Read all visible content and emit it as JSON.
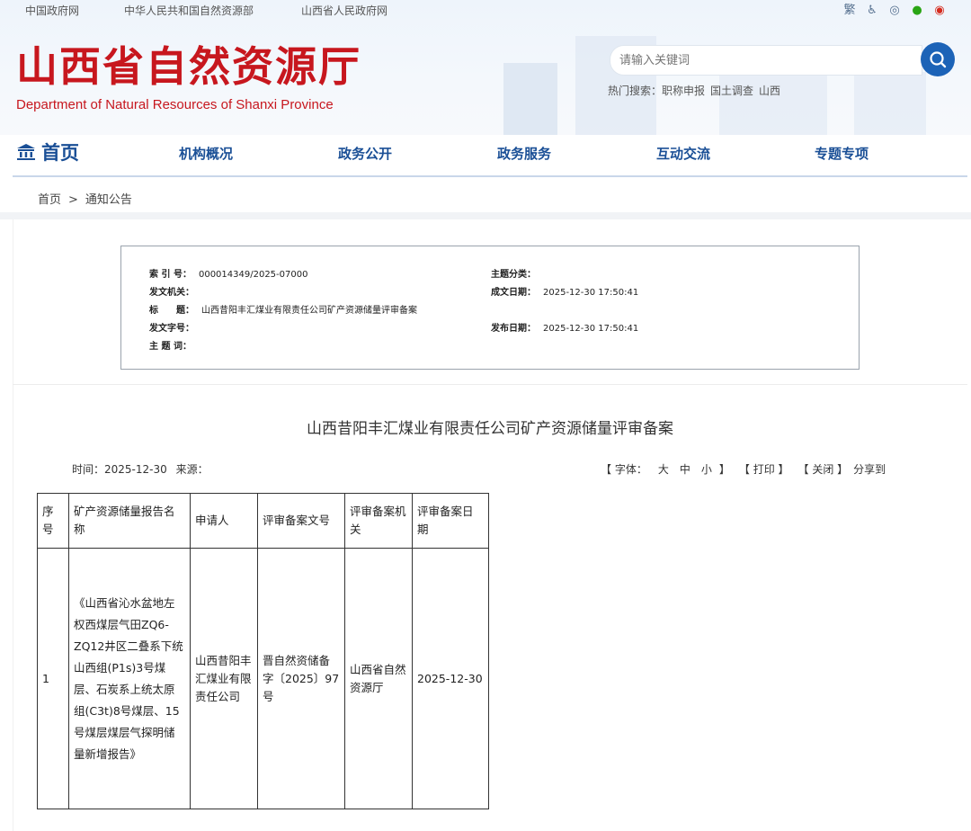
{
  "top_links": [
    "中国政府网",
    "中华人民共和国自然资源部",
    "山西省人民政府网"
  ],
  "top_icons": [
    {
      "name": "traditional-chinese-icon",
      "glyph": "繁"
    },
    {
      "name": "accessibility-icon",
      "glyph": "♿"
    },
    {
      "name": "voice-icon",
      "glyph": "◎"
    },
    {
      "name": "wechat-icon",
      "glyph": "●"
    },
    {
      "name": "weibo-icon",
      "glyph": "◉"
    }
  ],
  "header": {
    "logo_cn": "山西省自然资源厅",
    "logo_en": "Department of Natural Resources of Shanxi Province",
    "brand_color": "#c7171e",
    "search_placeholder": "请输入关键词",
    "hot_label": "热门搜索：",
    "hot_items": [
      "职称申报",
      "国土调查",
      "山西"
    ]
  },
  "nav": {
    "home": "首页",
    "items": [
      "机构概况",
      "政务公开",
      "政务服务",
      "互动交流",
      "专题专项"
    ]
  },
  "breadcrumb": {
    "home": "首页",
    "sep": ">",
    "current": "通知公告"
  },
  "meta": {
    "index_label": "索 引 号：",
    "index_value": "000014349/2025-07000",
    "issuer_label": "发文机关：",
    "issuer_value": "",
    "title_label": "标　　题：",
    "title_value": "山西昔阳丰汇煤业有限责任公司矿产资源储量评审备案",
    "docno_label": "发文字号：",
    "docno_value": "",
    "keywords_label": "主 题 词：",
    "keywords_value": "",
    "category_label": "主题分类：",
    "category_value": "",
    "created_label": "成文日期：",
    "created_value": "2025-12-30 17:50:41",
    "published_label": "发布日期：",
    "published_value": "2025-12-30 17:50:41"
  },
  "article": {
    "title": "山西昔阳丰汇煤业有限责任公司矿产资源储量评审备案",
    "time_label": "时间：",
    "time_value": "2025-12-30",
    "source_label": "来源：",
    "font_label": "【 字体：",
    "font_large": "大",
    "font_medium": "中",
    "font_small": "小",
    "font_close": "】",
    "print": "【 打印 】",
    "close": "【 关闭 】",
    "share": "分享到"
  },
  "table": {
    "headers": [
      "序号",
      "矿产资源储量报告名称",
      "申请人",
      "评审备案文号",
      "评审备案机关",
      "评审备案日期"
    ],
    "rows": [
      {
        "no": "1",
        "report": "《山西省沁水盆地左权西煤层气田ZQ6-ZQ12井区二叠系下统山西组(P1s)3号煤层、石炭系上统太原组(C3t)8号煤层、15号煤层煤层气探明储量新增报告》",
        "applicant": "山西昔阳丰汇煤业有限责任公司",
        "doc_no": "晋自然资储备字〔2025〕97号",
        "authority": "山西省自然资源厅",
        "date": "2025-12-30"
      }
    ]
  }
}
